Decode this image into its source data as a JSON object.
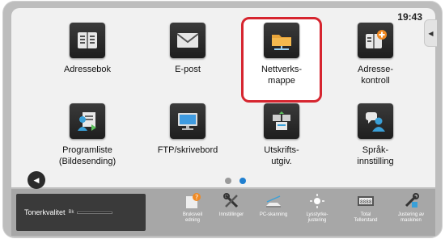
{
  "clock": "19:43",
  "tiles": [
    {
      "label": "Adressebok",
      "icon": "address-book-icon"
    },
    {
      "label": "E-post",
      "icon": "envelope-icon"
    },
    {
      "label": "Nettverks-\nmappe",
      "icon": "network-folder-icon"
    },
    {
      "label": "Adresse-\nkontroll",
      "icon": "address-control-icon"
    },
    {
      "label": "Programliste\n(Bildesending)",
      "icon": "program-list-icon"
    },
    {
      "label": "FTP/skrivebord",
      "icon": "monitor-icon"
    },
    {
      "label": "Utskrifts-\nutgiv.",
      "icon": "print-release-icon"
    },
    {
      "label": "Språk-\ninnstilling",
      "icon": "language-setting-icon"
    }
  ],
  "highlight_color": "#d6252f",
  "page_indicator": {
    "pages": 2,
    "current": 2
  },
  "toner": {
    "label": "Tonerkvalitet",
    "color_label": "Bk"
  },
  "utilities": [
    {
      "label": "Bruksveil\nedning",
      "icon": "user-guide-icon"
    },
    {
      "label": "Innstillinger",
      "icon": "settings-tools-icon"
    },
    {
      "label": "PC-skanning",
      "icon": "pc-scan-icon"
    },
    {
      "label": "Lysstyrke-\njustering",
      "icon": "brightness-icon"
    },
    {
      "label": "Total\nTellerstand",
      "icon": "counter-icon"
    },
    {
      "label": "Justering av\nmaskinen",
      "icon": "machine-adjust-icon"
    }
  ]
}
